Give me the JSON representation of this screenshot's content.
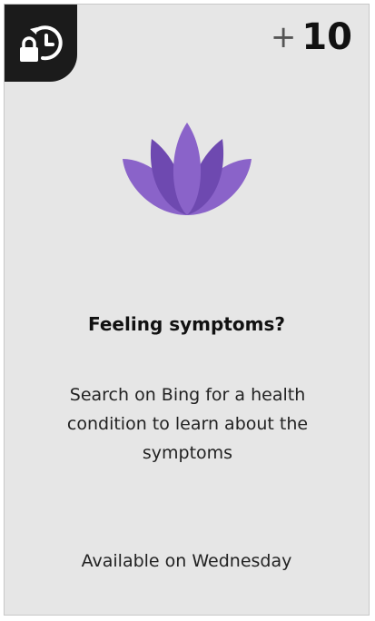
{
  "card": {
    "lock_icon": "lock-history-icon",
    "points": {
      "plus": "+",
      "value": "10"
    },
    "image_icon": "lotus-icon",
    "title": "Feeling symptoms?",
    "description": "Search on Bing for a health condition to learn about the symptoms",
    "availability": "Available on Wednesday"
  },
  "colors": {
    "card_background": "#e6e6e6",
    "badge_background": "#1b1b1b",
    "lotus_primary": "#8a63c9",
    "lotus_secondary": "#6e49b0"
  }
}
